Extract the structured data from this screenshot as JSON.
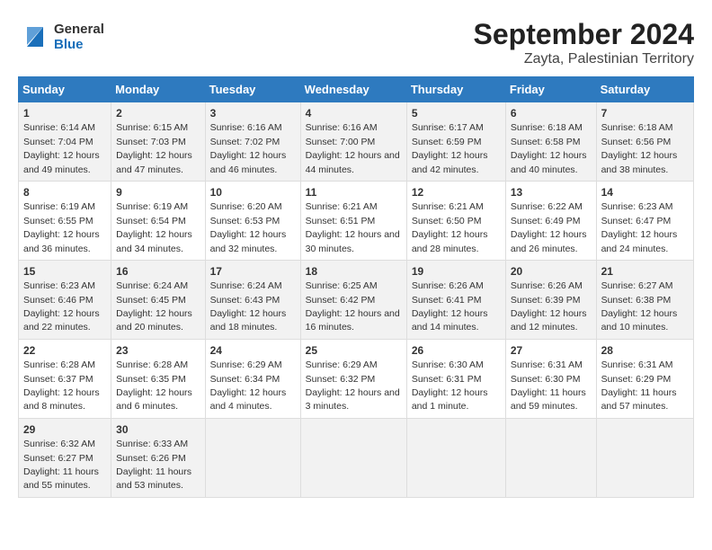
{
  "logo": {
    "line1": "General",
    "line2": "Blue"
  },
  "title": "September 2024",
  "subtitle": "Zayta, Palestinian Territory",
  "headers": [
    "Sunday",
    "Monday",
    "Tuesday",
    "Wednesday",
    "Thursday",
    "Friday",
    "Saturday"
  ],
  "weeks": [
    [
      {
        "day": "1",
        "sunrise": "6:14 AM",
        "sunset": "7:04 PM",
        "daylight": "12 hours and 49 minutes."
      },
      {
        "day": "2",
        "sunrise": "6:15 AM",
        "sunset": "7:03 PM",
        "daylight": "12 hours and 47 minutes."
      },
      {
        "day": "3",
        "sunrise": "6:16 AM",
        "sunset": "7:02 PM",
        "daylight": "12 hours and 46 minutes."
      },
      {
        "day": "4",
        "sunrise": "6:16 AM",
        "sunset": "7:00 PM",
        "daylight": "12 hours and 44 minutes."
      },
      {
        "day": "5",
        "sunrise": "6:17 AM",
        "sunset": "6:59 PM",
        "daylight": "12 hours and 42 minutes."
      },
      {
        "day": "6",
        "sunrise": "6:18 AM",
        "sunset": "6:58 PM",
        "daylight": "12 hours and 40 minutes."
      },
      {
        "day": "7",
        "sunrise": "6:18 AM",
        "sunset": "6:56 PM",
        "daylight": "12 hours and 38 minutes."
      }
    ],
    [
      {
        "day": "8",
        "sunrise": "6:19 AM",
        "sunset": "6:55 PM",
        "daylight": "12 hours and 36 minutes."
      },
      {
        "day": "9",
        "sunrise": "6:19 AM",
        "sunset": "6:54 PM",
        "daylight": "12 hours and 34 minutes."
      },
      {
        "day": "10",
        "sunrise": "6:20 AM",
        "sunset": "6:53 PM",
        "daylight": "12 hours and 32 minutes."
      },
      {
        "day": "11",
        "sunrise": "6:21 AM",
        "sunset": "6:51 PM",
        "daylight": "12 hours and 30 minutes."
      },
      {
        "day": "12",
        "sunrise": "6:21 AM",
        "sunset": "6:50 PM",
        "daylight": "12 hours and 28 minutes."
      },
      {
        "day": "13",
        "sunrise": "6:22 AM",
        "sunset": "6:49 PM",
        "daylight": "12 hours and 26 minutes."
      },
      {
        "day": "14",
        "sunrise": "6:23 AM",
        "sunset": "6:47 PM",
        "daylight": "12 hours and 24 minutes."
      }
    ],
    [
      {
        "day": "15",
        "sunrise": "6:23 AM",
        "sunset": "6:46 PM",
        "daylight": "12 hours and 22 minutes."
      },
      {
        "day": "16",
        "sunrise": "6:24 AM",
        "sunset": "6:45 PM",
        "daylight": "12 hours and 20 minutes."
      },
      {
        "day": "17",
        "sunrise": "6:24 AM",
        "sunset": "6:43 PM",
        "daylight": "12 hours and 18 minutes."
      },
      {
        "day": "18",
        "sunrise": "6:25 AM",
        "sunset": "6:42 PM",
        "daylight": "12 hours and 16 minutes."
      },
      {
        "day": "19",
        "sunrise": "6:26 AM",
        "sunset": "6:41 PM",
        "daylight": "12 hours and 14 minutes."
      },
      {
        "day": "20",
        "sunrise": "6:26 AM",
        "sunset": "6:39 PM",
        "daylight": "12 hours and 12 minutes."
      },
      {
        "day": "21",
        "sunrise": "6:27 AM",
        "sunset": "6:38 PM",
        "daylight": "12 hours and 10 minutes."
      }
    ],
    [
      {
        "day": "22",
        "sunrise": "6:28 AM",
        "sunset": "6:37 PM",
        "daylight": "12 hours and 8 minutes."
      },
      {
        "day": "23",
        "sunrise": "6:28 AM",
        "sunset": "6:35 PM",
        "daylight": "12 hours and 6 minutes."
      },
      {
        "day": "24",
        "sunrise": "6:29 AM",
        "sunset": "6:34 PM",
        "daylight": "12 hours and 4 minutes."
      },
      {
        "day": "25",
        "sunrise": "6:29 AM",
        "sunset": "6:32 PM",
        "daylight": "12 hours and 3 minutes."
      },
      {
        "day": "26",
        "sunrise": "6:30 AM",
        "sunset": "6:31 PM",
        "daylight": "12 hours and 1 minute."
      },
      {
        "day": "27",
        "sunrise": "6:31 AM",
        "sunset": "6:30 PM",
        "daylight": "11 hours and 59 minutes."
      },
      {
        "day": "28",
        "sunrise": "6:31 AM",
        "sunset": "6:29 PM",
        "daylight": "11 hours and 57 minutes."
      }
    ],
    [
      {
        "day": "29",
        "sunrise": "6:32 AM",
        "sunset": "6:27 PM",
        "daylight": "11 hours and 55 minutes."
      },
      {
        "day": "30",
        "sunrise": "6:33 AM",
        "sunset": "6:26 PM",
        "daylight": "11 hours and 53 minutes."
      },
      null,
      null,
      null,
      null,
      null
    ]
  ],
  "labels": {
    "sunrise": "Sunrise:",
    "sunset": "Sunset:",
    "daylight": "Daylight:"
  }
}
